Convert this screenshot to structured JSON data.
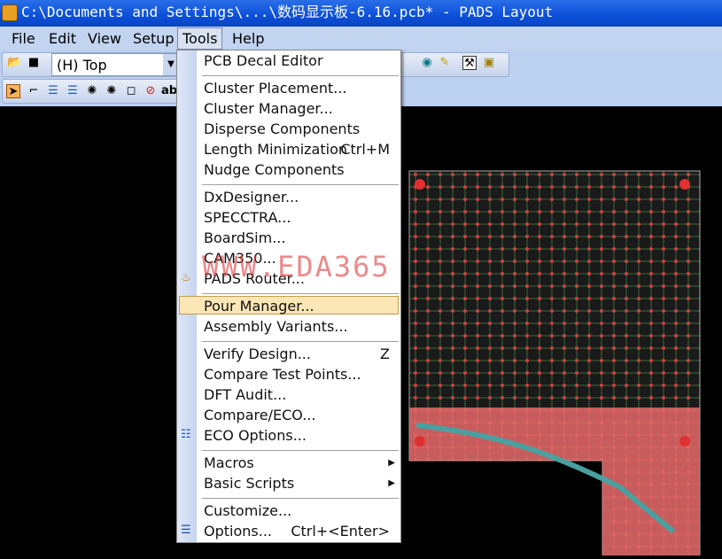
{
  "window": {
    "title": "C:\\Documents and Settings\\...\\数码显示板-6.16.pcb* - PADS Layout"
  },
  "menubar": [
    "File",
    "Edit",
    "View",
    "Setup",
    "Tools",
    "Help"
  ],
  "toolbar": {
    "layer_value": "(H) Top",
    "text_tool": "ab"
  },
  "tools_menu": {
    "items": [
      {
        "label": "PCB Decal Editor"
      },
      {
        "label": "Cluster Placement..."
      },
      {
        "label": "Cluster Manager..."
      },
      {
        "label": "Disperse Components"
      },
      {
        "label": "Length Minimization",
        "shortcut": "Ctrl+M"
      },
      {
        "label": "Nudge Components"
      },
      {
        "label": "DxDesigner..."
      },
      {
        "label": "SPECCTRA..."
      },
      {
        "label": "BoardSim..."
      },
      {
        "label": "CAM350..."
      },
      {
        "label": "PADS Router..."
      },
      {
        "label": "Pour Manager..."
      },
      {
        "label": "Assembly Variants..."
      },
      {
        "label": "Verify Design...",
        "shortcut": "Z"
      },
      {
        "label": "Compare Test Points..."
      },
      {
        "label": "DFT Audit..."
      },
      {
        "label": "Compare/ECO..."
      },
      {
        "label": "ECO Options..."
      },
      {
        "label": "Macros"
      },
      {
        "label": "Basic Scripts"
      },
      {
        "label": "Customize..."
      },
      {
        "label": "Options...",
        "shortcut": "Ctrl+<Enter>"
      }
    ],
    "highlighted": "Pour Manager..."
  },
  "watermark": "WWW.EDA365",
  "colors": {
    "title": "#0c4fd8",
    "menubar": "#c2d4f0",
    "highlight": "#fbe7b5",
    "board_copper": "#e86060"
  }
}
